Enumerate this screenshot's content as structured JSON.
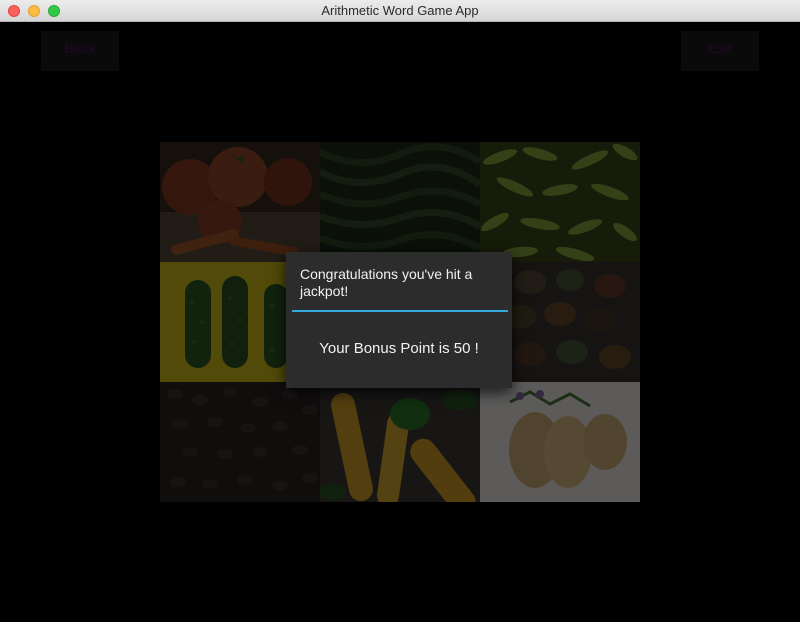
{
  "window": {
    "title": "Arithmetic Word Game App"
  },
  "toolbar": {
    "back_label": "Back",
    "exit_label": "Exit"
  },
  "tiles": [
    {
      "name": "tile-tomatoes",
      "subject": "tomatoes-and-carrots"
    },
    {
      "name": "tile-green-beans",
      "subject": "green-beans"
    },
    {
      "name": "tile-green-peppers",
      "subject": "green-chili-peppers"
    },
    {
      "name": "tile-cucumbers",
      "subject": "cucumbers-on-yellow"
    },
    {
      "name": "tile-mixed-vegetables",
      "subject": "mixed-vegetables"
    },
    {
      "name": "tile-mixed-vegetables-2",
      "subject": "mixed-vegetables"
    },
    {
      "name": "tile-beans",
      "subject": "dark-beans"
    },
    {
      "name": "tile-corn",
      "subject": "corn-and-peppers"
    },
    {
      "name": "tile-potatoes",
      "subject": "potatoes-on-white"
    }
  ],
  "dialog": {
    "title": "Congratulations you've hit a jackpot!",
    "message": "Your Bonus Point is 50 !"
  },
  "colors": {
    "accent": "#35a8e0",
    "dialog_bg": "#2c2c2c",
    "button_text": "#5a1466"
  }
}
